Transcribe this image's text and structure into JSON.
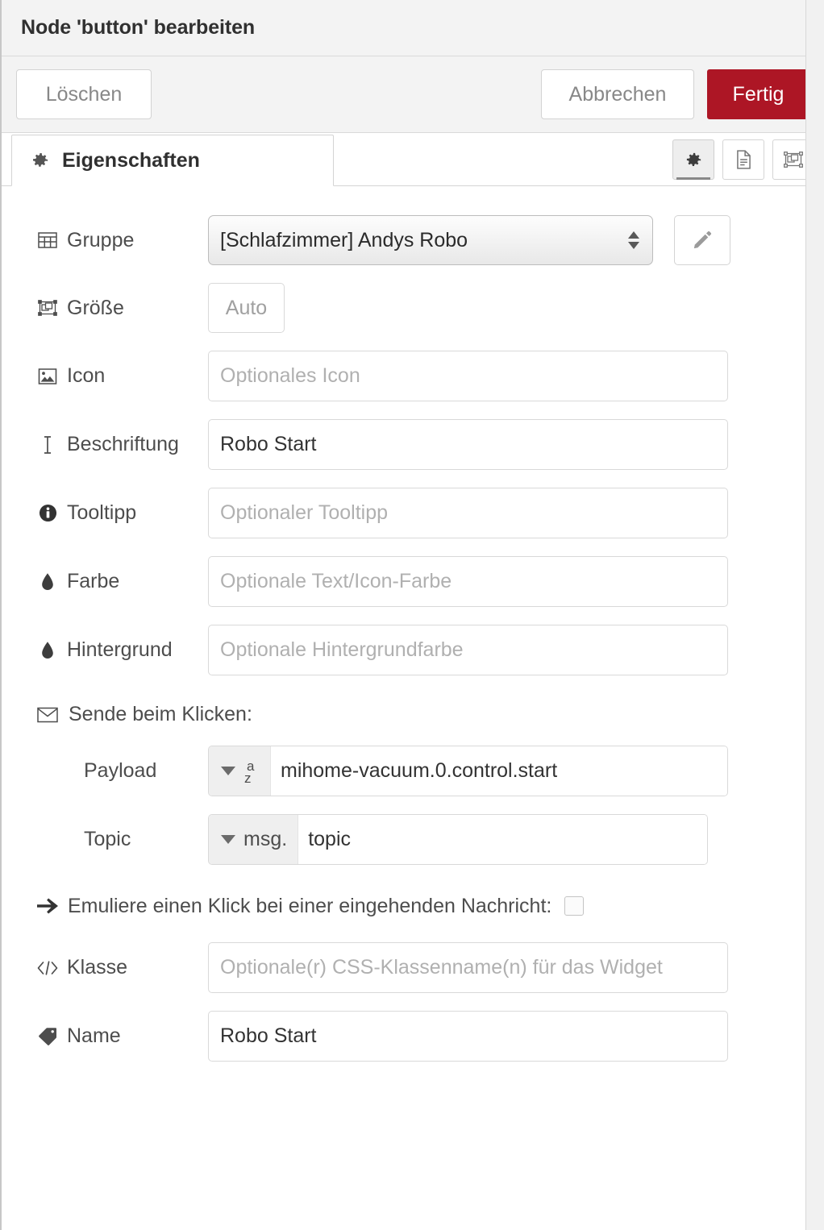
{
  "header": {
    "title": "Node 'button' bearbeiten"
  },
  "toolbar": {
    "delete_label": "Löschen",
    "cancel_label": "Abbrechen",
    "done_label": "Fertig"
  },
  "tabs": {
    "properties_label": "Eigenschaften",
    "tools": [
      {
        "name": "properties",
        "title": "Eigenschaften",
        "active": true
      },
      {
        "name": "description",
        "title": "Beschreibung",
        "active": false
      },
      {
        "name": "appearance",
        "title": "Erscheinungsbild",
        "active": false
      }
    ]
  },
  "form": {
    "group": {
      "label": "Gruppe",
      "icon": "table-icon",
      "value": "[Schlafzimmer] Andys Robo",
      "edit_button_icon": "pencil-icon"
    },
    "size": {
      "label": "Größe",
      "icon": "object-group-icon",
      "value": "Auto"
    },
    "icon": {
      "label": "Icon",
      "icon": "image-icon",
      "value": "",
      "placeholder": "Optionales Icon"
    },
    "caption": {
      "label": "Beschriftung",
      "icon": "text-cursor-icon",
      "value": "Robo Start",
      "placeholder": ""
    },
    "tooltip": {
      "label": "Tooltipp",
      "icon": "info-circle-icon",
      "value": "",
      "placeholder": "Optionaler Tooltipp"
    },
    "color": {
      "label": "Farbe",
      "icon": "tint-icon",
      "value": "",
      "placeholder": "Optionale Text/Icon-Farbe"
    },
    "background": {
      "label": "Hintergrund",
      "icon": "tint-icon",
      "value": "",
      "placeholder": "Optionale Hintergrundfarbe"
    },
    "send_section": {
      "label": "Sende beim Klicken:",
      "icon": "envelope-icon"
    },
    "payload": {
      "label": "Payload",
      "type": "str",
      "type_glyph_top": "a",
      "type_glyph_bottom": "z",
      "value": "mihome-vacuum.0.control.start",
      "placeholder": ""
    },
    "topic": {
      "label": "Topic",
      "type": "msg.",
      "value": "topic",
      "placeholder": ""
    },
    "emulate": {
      "label": "Emuliere einen Klick bei einer eingehenden Nachricht:",
      "icon": "arrow-right-icon",
      "checked": false
    },
    "css_class": {
      "label": "Klasse",
      "icon": "code-icon",
      "value": "",
      "placeholder": "Optionale(r) CSS-Klassenname(n) für das Widget"
    },
    "name": {
      "label": "Name",
      "icon": "tag-icon",
      "value": "Robo Start",
      "placeholder": ""
    }
  },
  "colors": {
    "primary_button": "#ad1625",
    "header_background": "#f3f3f3",
    "text": "#4d4d4d",
    "placeholder": "#b0b0b0",
    "border": "#d9d9d9"
  }
}
